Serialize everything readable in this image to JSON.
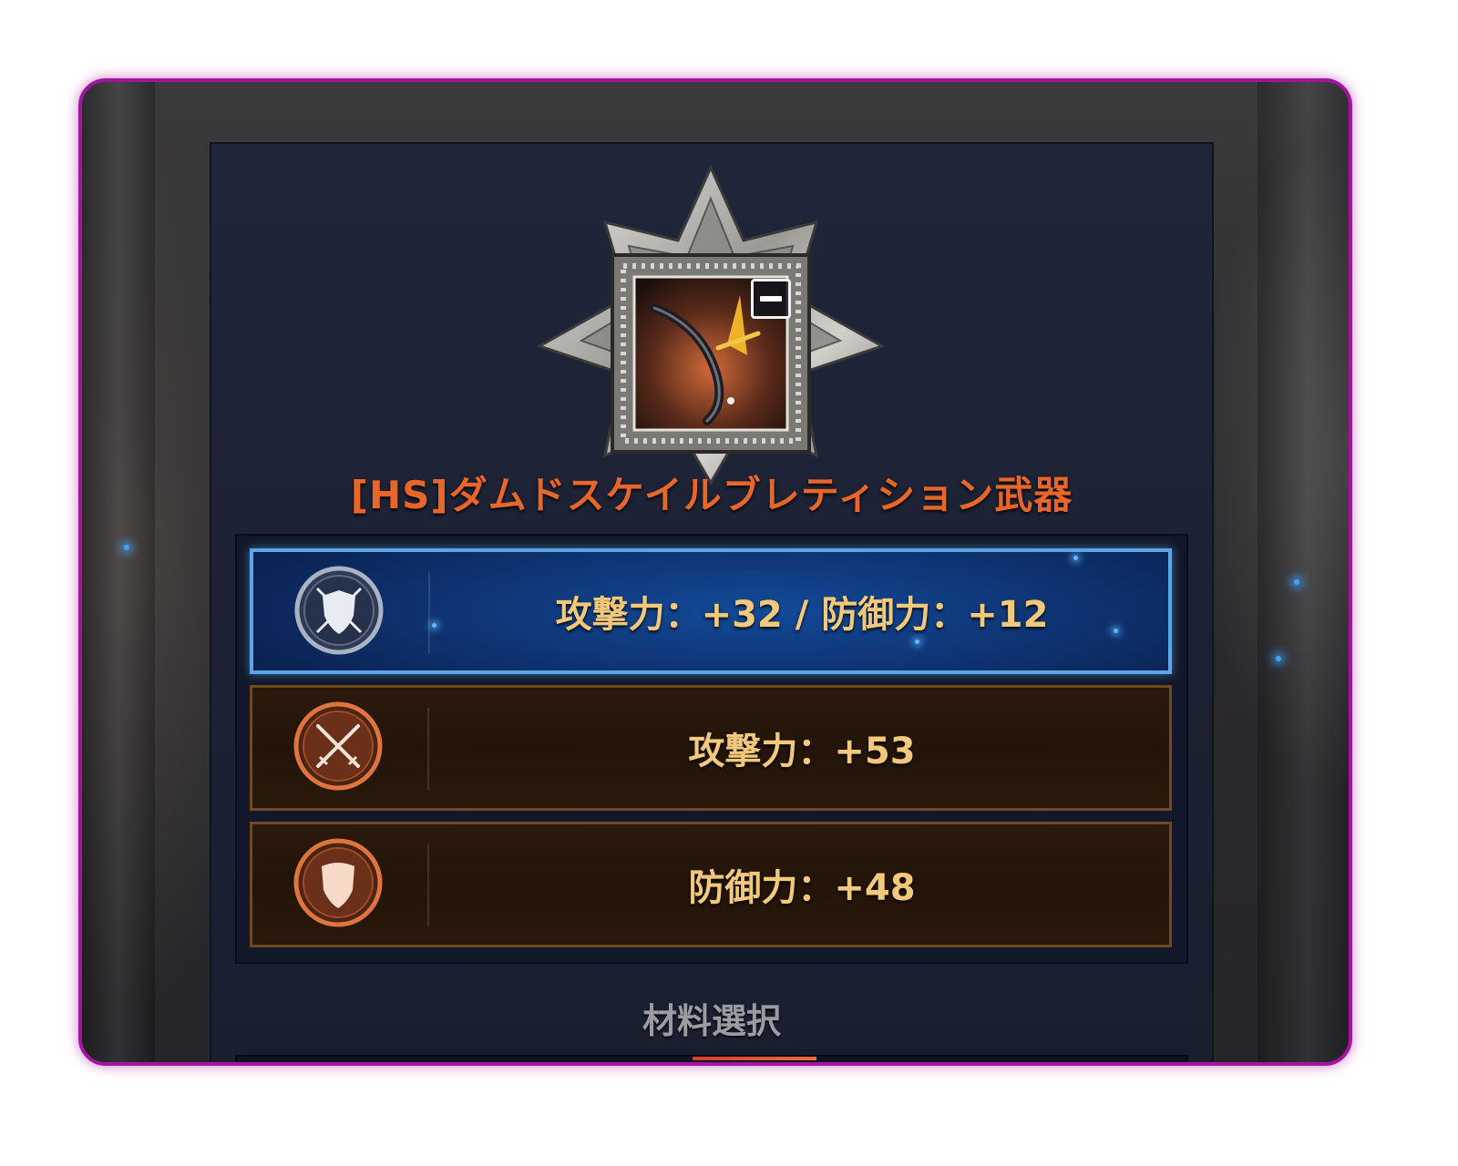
{
  "item": {
    "name": "[HS]ダムドスケイルブレティション武器",
    "icon": "bow-icon",
    "badge_icon": "minus-icon"
  },
  "options": [
    {
      "label": "攻撃力：+32 / 防御力：+12",
      "icon": "crossed-swords-shield-icon",
      "selected": true,
      "style": "blue"
    },
    {
      "label": "攻撃力：+53",
      "icon": "crossed-swords-icon",
      "selected": false,
      "style": "bronze"
    },
    {
      "label": "防御力：+48",
      "icon": "shield-icon",
      "selected": false,
      "style": "bronze"
    }
  ],
  "material": {
    "label": "材料選択"
  },
  "colors": {
    "frame_border": "#a4159f",
    "item_name": "#e8662a",
    "option_text": "#f2c97a",
    "selected_border": "#5aa6e6",
    "bronze_border": "#6e4a23",
    "material_label": "#9b9ca3"
  }
}
